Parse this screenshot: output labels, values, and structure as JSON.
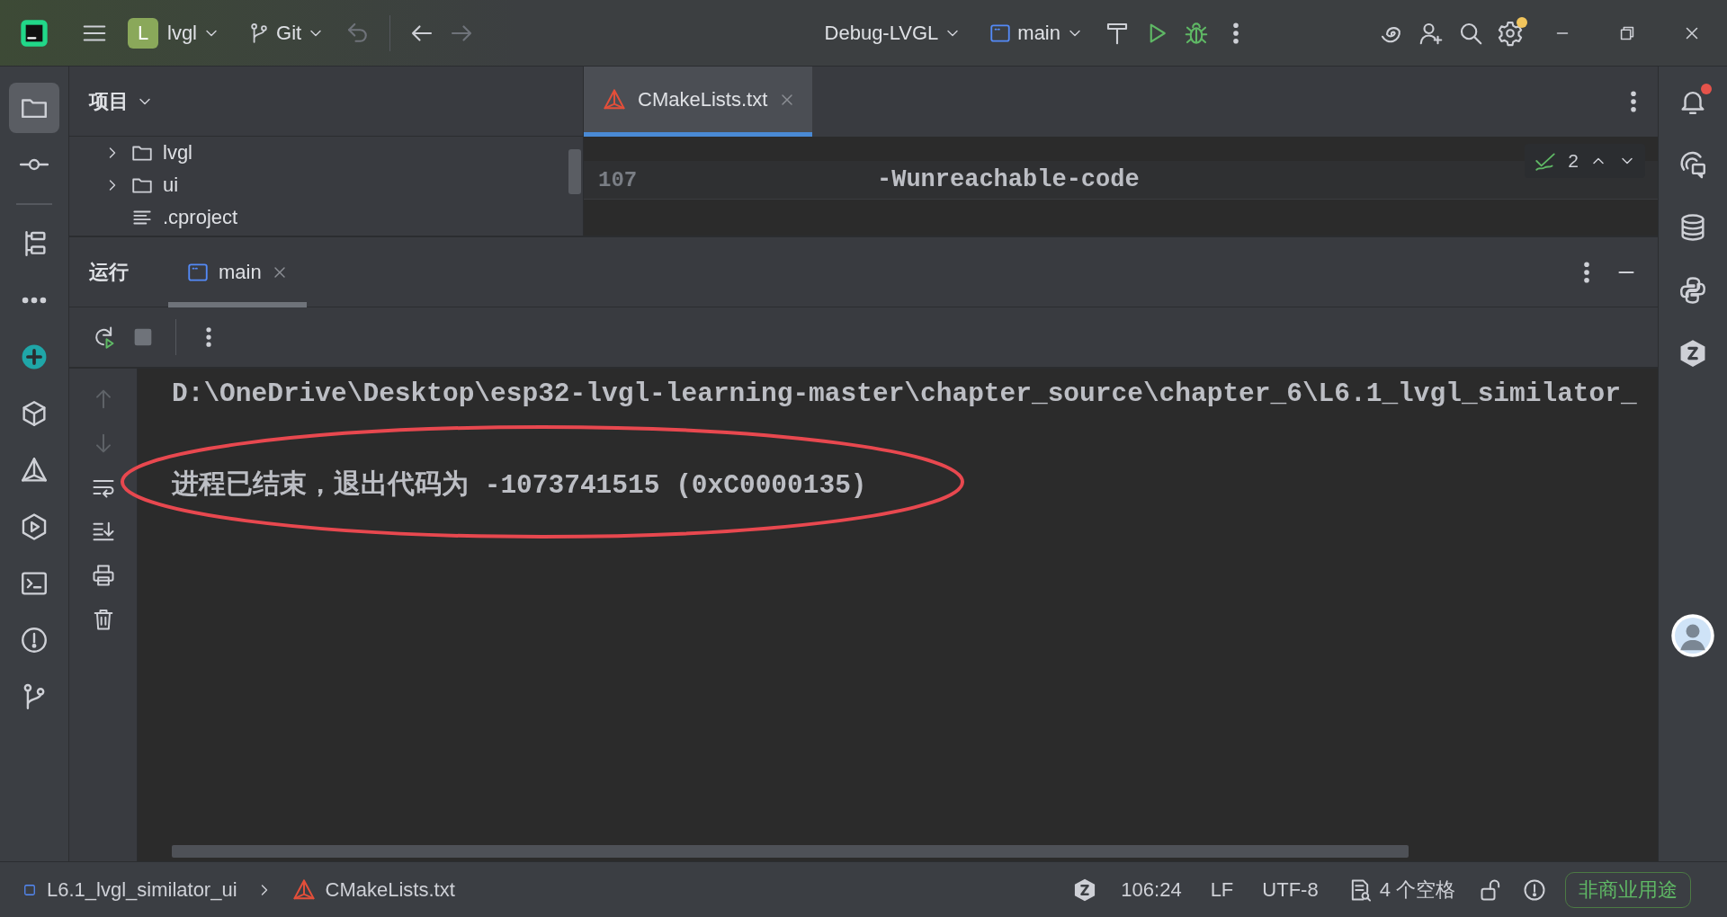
{
  "title_bar": {
    "project_initial": "L",
    "project": "lvgl",
    "vcs": "Git",
    "run_config_group": "Debug-LVGL",
    "run_config": "main",
    "settings_badge": true
  },
  "left_toolbar": {
    "primary": [
      {
        "kind": "folder",
        "selected": true
      },
      {
        "kind": "commit",
        "selected": false
      }
    ],
    "secondary": [
      {
        "kind": "structure",
        "selected": false
      },
      {
        "kind": "more",
        "selected": false
      },
      {
        "kind": "add",
        "selected": false
      },
      {
        "kind": "packages",
        "selected": false
      },
      {
        "kind": "cmake",
        "selected": false
      },
      {
        "kind": "services",
        "selected": false
      },
      {
        "kind": "terminal",
        "selected": false
      },
      {
        "kind": "problems",
        "selected": false
      },
      {
        "kind": "git",
        "selected": false
      }
    ]
  },
  "project_panel": {
    "title": "项目",
    "tree": [
      {
        "name": "lvgl",
        "kind": "folder",
        "expanded": false
      },
      {
        "name": "ui",
        "kind": "folder",
        "expanded": false
      },
      {
        "name": ".cproject",
        "kind": "file"
      }
    ]
  },
  "editor": {
    "tabs": [
      {
        "label": "CMakeLists.txt",
        "selected": true
      }
    ],
    "lines": [
      {
        "number": "107",
        "code": "-Wunreachable-code"
      }
    ],
    "inspections": "2"
  },
  "run_panel": {
    "title": "运行",
    "tabs": [
      {
        "label": "main",
        "selected": true
      }
    ],
    "gutter": [
      {
        "kind": "up",
        "disabled": true
      },
      {
        "kind": "down",
        "disabled": true
      },
      {
        "kind": "wrap",
        "disabled": false
      },
      {
        "kind": "scroll-end",
        "disabled": false
      },
      {
        "kind": "print",
        "disabled": false
      },
      {
        "kind": "trash",
        "disabled": false
      }
    ],
    "output": [
      {
        "text": "D:\\OneDrive\\Desktop\\esp32-lvgl-learning-master\\chapter_source\\chapter_6\\L6.1_lvgl_similator_",
        "highlighted": false
      },
      {
        "text": "进程已结束，退出代码为 -1073741515 (0xC0000135)",
        "highlighted": true
      }
    ]
  },
  "right_toolbar": {
    "items": [
      {
        "kind": "bell",
        "badge": true
      },
      {
        "kind": "ai-chat",
        "badge": false
      },
      {
        "kind": "database",
        "badge": false
      },
      {
        "kind": "python",
        "badge": false
      },
      {
        "kind": "plugin",
        "badge": false
      }
    ]
  },
  "status_bar": {
    "breadcrumbs": [
      "L6.1_lvgl_similator_ui",
      "CMakeLists.txt"
    ],
    "position": "106:24",
    "line_separator": "LF",
    "encoding": "UTF-8",
    "indent": "4 个空格",
    "license": "非商业用途"
  }
}
